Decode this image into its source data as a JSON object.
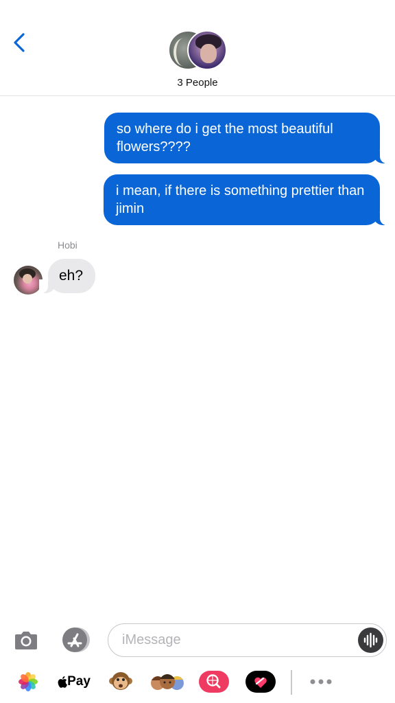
{
  "header": {
    "back_icon": "chevron-left-icon",
    "group_label": "3 People",
    "accent": "#0a66d6"
  },
  "messages": [
    {
      "direction": "outgoing",
      "text": "so where do i get the most beautiful flowers????"
    },
    {
      "direction": "outgoing",
      "text": "i mean, if there is something prettier than jimin"
    },
    {
      "direction": "incoming",
      "sender": "Hobi",
      "text": "eh?"
    }
  ],
  "composer": {
    "placeholder": "iMessage",
    "camera_icon": "camera-icon",
    "apps_icon": "app-store-icon",
    "mic_icon": "audio-waveform-icon"
  },
  "app_strip": {
    "items": [
      {
        "name": "photos-icon"
      },
      {
        "name": "apple-pay-icon",
        "label": "Pay"
      },
      {
        "name": "monkey-animoji-icon"
      },
      {
        "name": "memoji-icon"
      },
      {
        "name": "image-search-icon"
      },
      {
        "name": "digital-touch-heart-icon"
      },
      {
        "name": "more-icon"
      }
    ]
  },
  "colors": {
    "outgoing_bubble": "#0a66d6",
    "incoming_bubble": "#e9e9eb",
    "sender_label": "#8a8a8e"
  }
}
